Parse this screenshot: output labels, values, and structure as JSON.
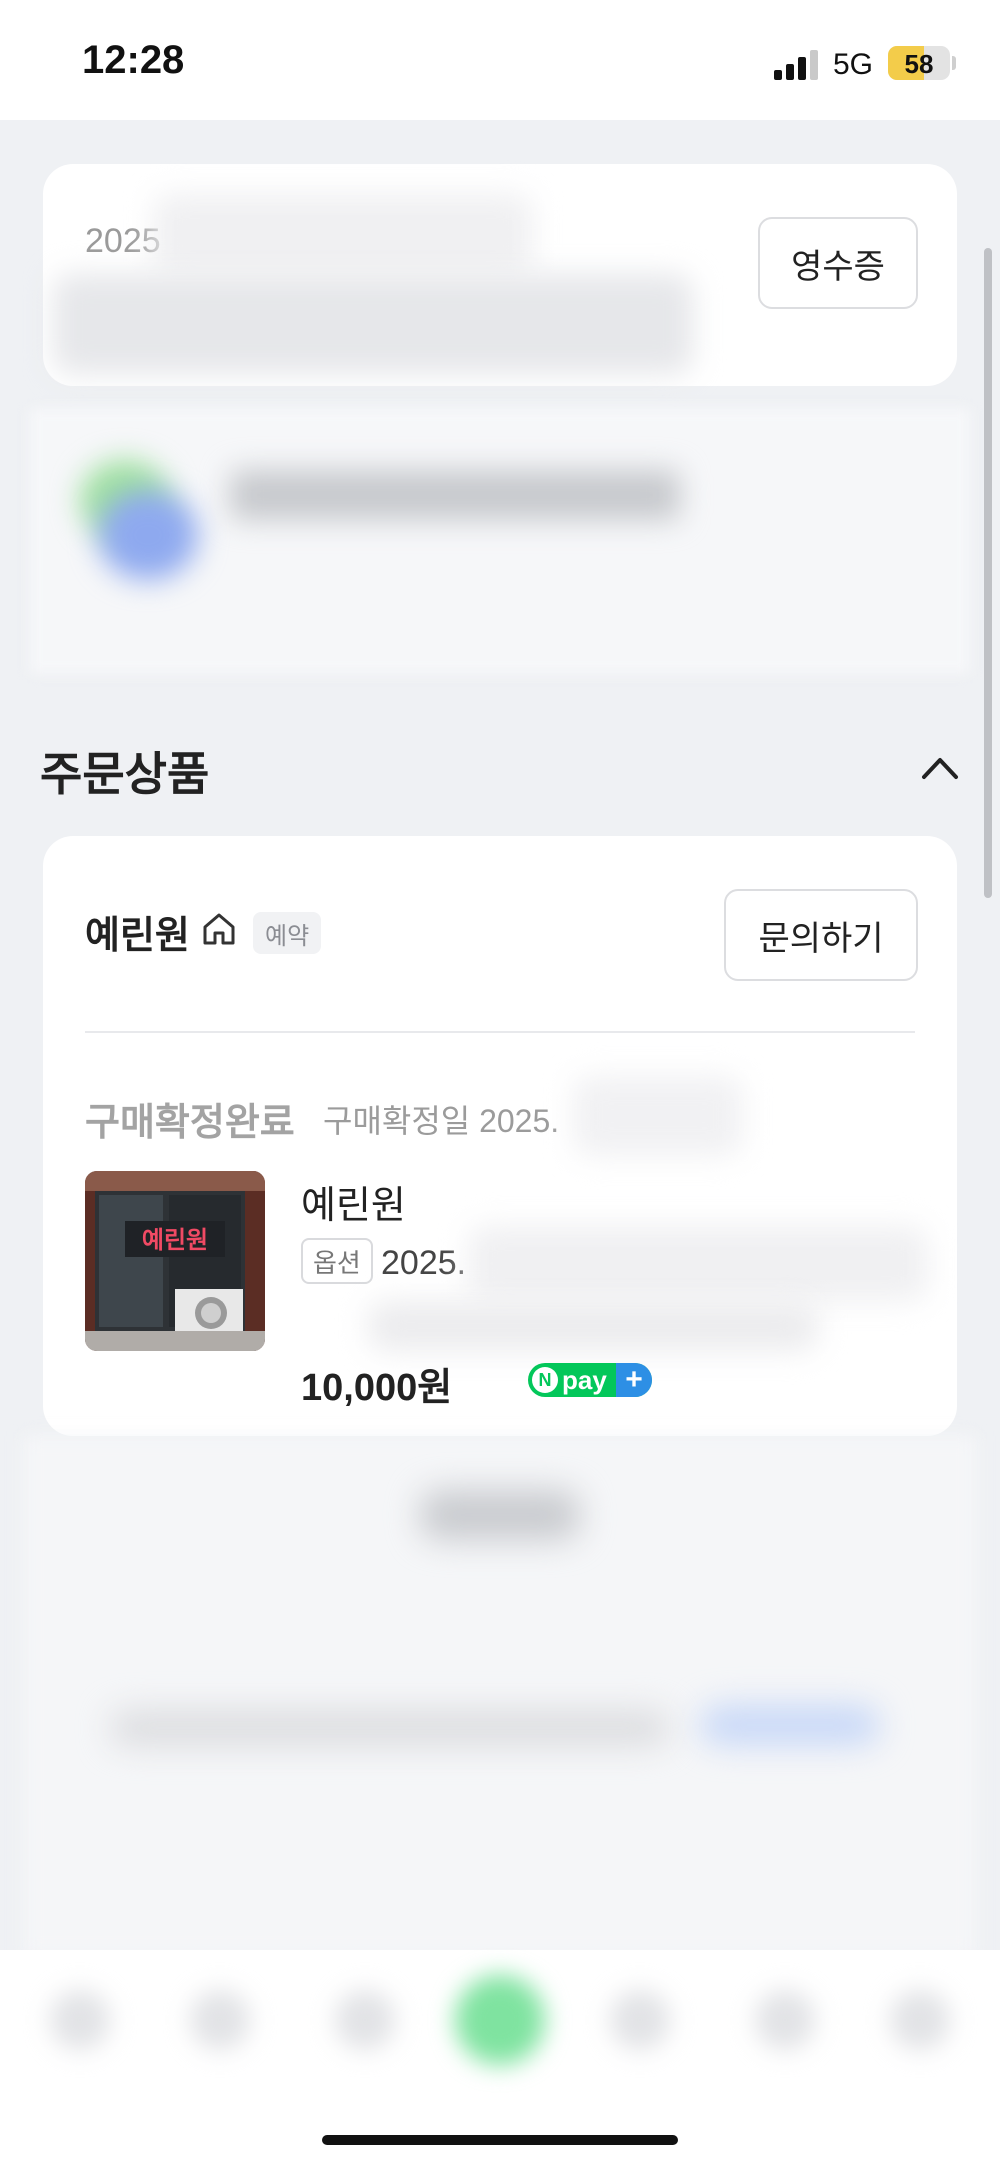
{
  "status_bar": {
    "time": "12:28",
    "network": "5G",
    "battery_level": "58",
    "battery_fraction": 0.58
  },
  "receipt_card": {
    "date_partial": "2025",
    "receipt_button": "영수증"
  },
  "order_section": {
    "title": "주문상품"
  },
  "store": {
    "name": "예린원",
    "badge": "예약",
    "inquiry_button": "문의하기"
  },
  "order_item": {
    "status": "구매확정완료",
    "confirm_date": "구매확정일 2025.",
    "product_name": "예린원",
    "option_tag": "옵션",
    "option_value": "2025.",
    "price": "10,000원",
    "thumbnail_sign": "예린원",
    "npay_label": "pay",
    "npay_n": "N",
    "npay_plus": "+"
  },
  "icons": {
    "home": "home-icon",
    "chevron": "chevron-up-icon",
    "signal": "signal-icon"
  },
  "colors": {
    "background": "#eff1f4",
    "card": "#ffffff",
    "npay_green": "#03c75a",
    "npay_blue": "#2d8fe5",
    "battery_yellow": "#f3cc4a"
  }
}
